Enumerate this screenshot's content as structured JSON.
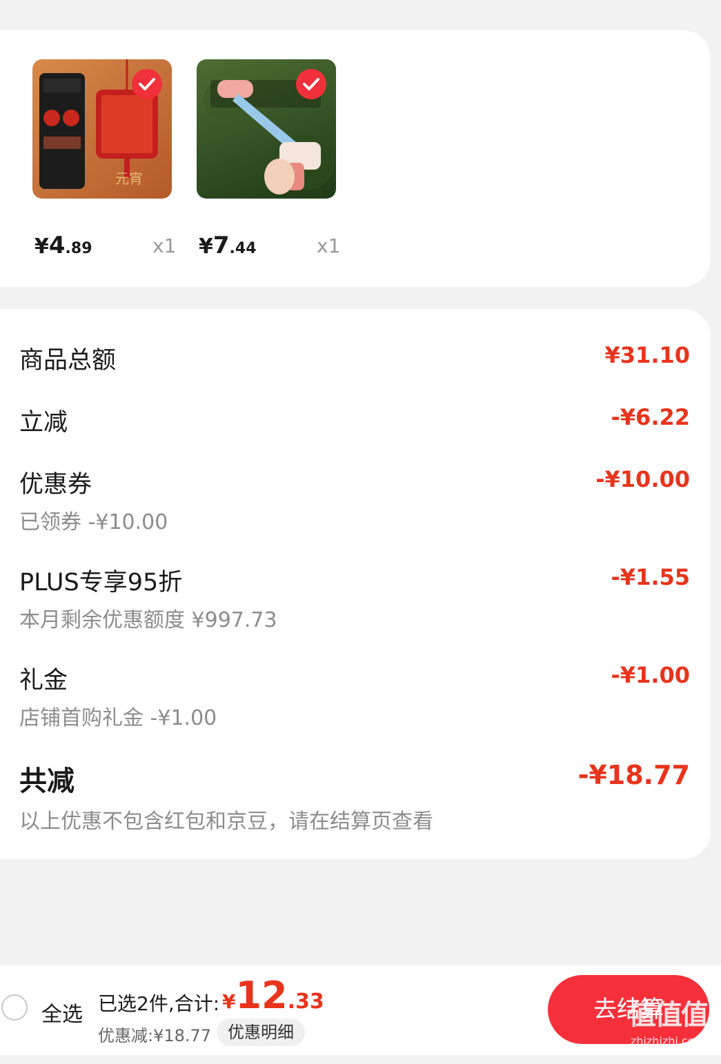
{
  "products": [
    {
      "price_symbol": "¥",
      "price_int": "4",
      "price_dec": ".89",
      "qty": "x1"
    },
    {
      "price_symbol": "¥",
      "price_int": "7",
      "price_dec": ".44",
      "qty": "x1"
    }
  ],
  "summary": {
    "total_label": "商品总额",
    "total_value": "¥31.10",
    "instant_label": "立减",
    "instant_value": "-¥6.22",
    "coupon_label": "优惠券",
    "coupon_value": "-¥10.00",
    "coupon_sub": "已领券 -¥10.00",
    "plus_label": "PLUS专享95折",
    "plus_value": "-¥1.55",
    "plus_sub": "本月剩余优惠额度 ¥997.73",
    "gift_label": "礼金",
    "gift_value": "-¥1.00",
    "gift_sub": "店铺首购礼金 -¥1.00",
    "saved_label": "共减",
    "saved_value": "-¥18.77",
    "note": "以上优惠不包含红包和京豆，请在结算页查看"
  },
  "bottom": {
    "select_all": "全选",
    "selected_text": "已选2件,合计:",
    "total_symbol": "¥",
    "total_int": "12",
    "total_dec": ".33",
    "discount_text": "优惠减:¥18.77",
    "detail_button": "优惠明细",
    "checkout_button": "去结算",
    "watermark": "值值值"
  },
  "colors": {
    "accent": "#e8341c",
    "button": "#f5303a"
  }
}
